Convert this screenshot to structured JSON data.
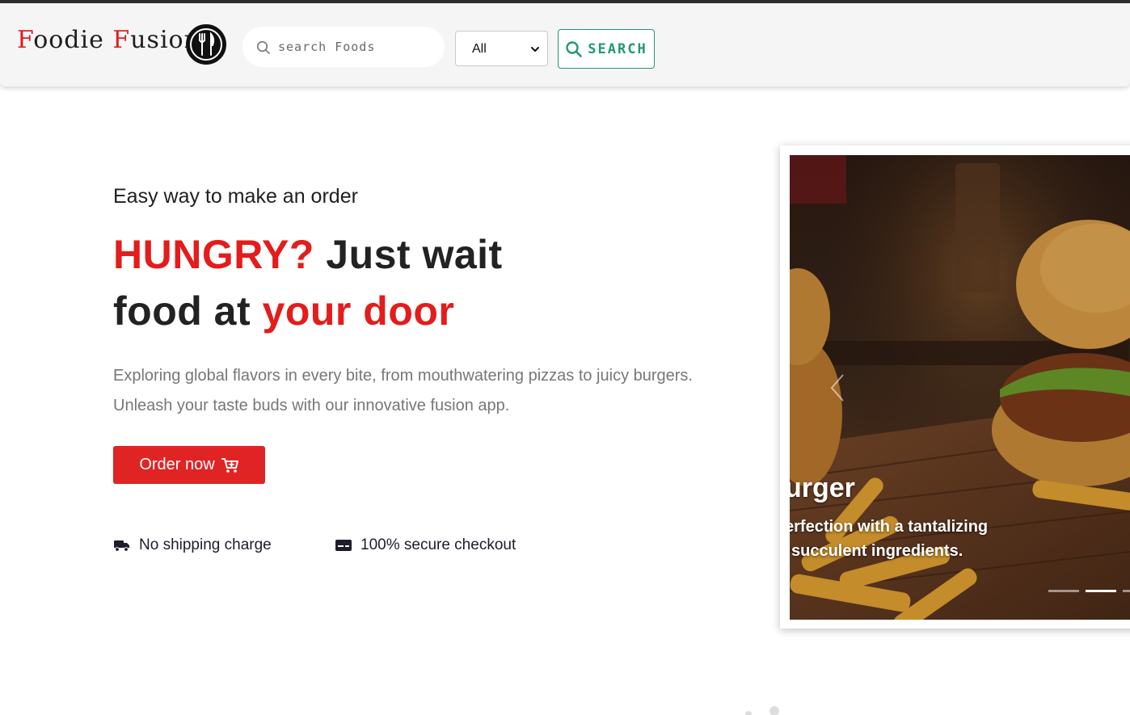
{
  "navbar": {
    "brand_first": "F",
    "brand_first_rest": "oodie ",
    "brand_second": "F",
    "brand_second_rest": "usion",
    "search_placeholder": "search Foods",
    "category_selected": "All",
    "search_button_label": "SEARCH"
  },
  "hero": {
    "eyebrow": "Easy way to make an order",
    "headline_red_1": "HUNGRY?",
    "headline_dark_1": " Just wait",
    "headline_dark_2": "food at ",
    "headline_red_2": "your door",
    "description": "Exploring global flavors in every bite, from mouthwatering pizzas to juicy burgers. Unleash your taste buds with our innovative fusion app.",
    "order_button_label": "Order now",
    "features": [
      {
        "label": "No shipping charge",
        "icon": "truck-icon"
      },
      {
        "label": "100% secure checkout",
        "icon": "credit-card-icon"
      }
    ]
  },
  "carousel": {
    "caption_title": "urger",
    "caption_line_1": "erfection with a tantalizing",
    "caption_line_2": "succulent ingredients.",
    "active_slide": 1,
    "slide_count": 3
  },
  "colors": {
    "accent_red": "#e31c1c",
    "button_red": "#e02424",
    "search_green": "#1f9a6f",
    "text_dark": "#222222",
    "text_muted": "#777777"
  }
}
